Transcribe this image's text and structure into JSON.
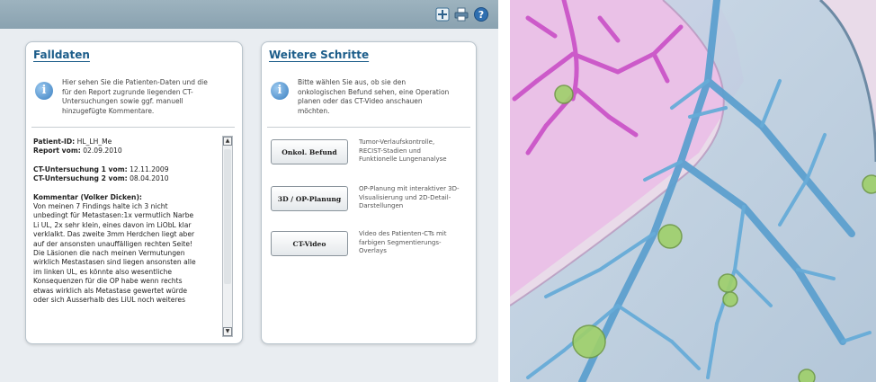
{
  "toolbar": {
    "icons": [
      "expand-icon",
      "print-icon",
      "help-icon"
    ]
  },
  "falldaten": {
    "title": "Falldaten",
    "info_lines": [
      "Hier sehen Sie die Patienten-Daten und die",
      "für den Report zugrunde liegenden CT-",
      "Untersuchungen sowie ggf. manuell",
      "hinzugefügte Kommentare."
    ],
    "patient_id_label": "Patient-ID:",
    "patient_id": " HL_LH_Me",
    "report_label": "Report vom:",
    "report_date": " 02.09.2010",
    "ct1_label": "CT-Untersuchung 1 vom:",
    "ct1_date": " 12.11.2009",
    "ct2_label": "CT-Untersuchung 2 vom:",
    "ct2_date": " 08.04.2010",
    "comment_heading": "Kommentar (Volker Dicken):",
    "comment_lines": [
      "Von meinen 7 Findings halte ich 3 nicht",
      "unbedingt für Metastasen:1x vermutlich Narbe",
      "Li UL, 2x sehr klein, eines davon im LiObL klar",
      "verklalkt. Das zweite 3mm Herdchen liegt aber",
      "auf der ansonsten unauffälligen rechten Seite!",
      "Die Läsionen die nach meinen Vermutungen",
      "wirklich Mestastasen sind liegen ansonsten alle",
      "im linken UL, es könnte also wesentliche",
      "Konsequenzen für die OP habe wenn rechts",
      "etwas wirklich als Metastase gewertet würde",
      "oder sich Ausserhalb des LiUL noch weiteres"
    ]
  },
  "schritte": {
    "title": "Weitere Schritte",
    "info_lines": [
      "Bitte wählen Sie aus, ob sie den",
      "onkologischen Befund sehen, eine Operation",
      "planen oder das CT-Video anschauen",
      "möchten."
    ],
    "buttons": [
      {
        "label": "Onkol. Befund",
        "desc": [
          "Tumor-Verlaufskontrolle,",
          "RECIST-Stadien und",
          "Funktionelle Lungenanalyse"
        ]
      },
      {
        "label": "3D / OP-Planung",
        "desc": [
          "OP-Planung mit interaktiver 3D-",
          "Visualisierung und 2D-Detail-",
          "Darstellungen"
        ]
      },
      {
        "label": "CT-Video",
        "desc": [
          "Video des Patienten-CTs mit",
          "farbigen Segmentierungs-",
          "Overlays"
        ]
      }
    ]
  },
  "colors": {
    "accent": "#1c5d8a",
    "topbar": "#93aab7",
    "background": "#e9edf1"
  }
}
